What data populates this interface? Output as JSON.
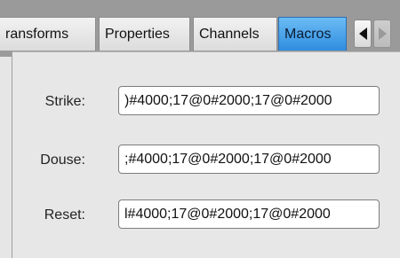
{
  "tabs": [
    {
      "label": "ransforms",
      "selected": false
    },
    {
      "label": "Properties",
      "selected": false
    },
    {
      "label": "Channels",
      "selected": false
    },
    {
      "label": "Macros",
      "selected": true
    }
  ],
  "macros": {
    "strike": {
      "label": "Strike:",
      "value": ")#4000;17@0#2000;17@0#2000"
    },
    "douse": {
      "label": "Douse:",
      "value": ";#4000;17@0#2000;17@0#2000"
    },
    "reset": {
      "label": "Reset:",
      "value": "l#4000;17@0#2000;17@0#2000"
    }
  },
  "colors": {
    "selected_tab": "#3d9be6",
    "chrome": "#9a9a9a",
    "panel": "#e7e7e7"
  },
  "icons": [
    "scroll-left-icon",
    "scroll-right-icon"
  ]
}
